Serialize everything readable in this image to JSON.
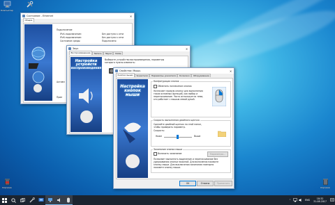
{
  "desktop": {
    "icons": [
      {
        "label": "Компьютер"
      },
      {
        "label": ""
      },
      {
        "label": "Корзина"
      },
      {
        "label": "Корзина"
      }
    ]
  },
  "win1": {
    "title": "Состояние - Ethernet",
    "tab": "Общие",
    "heading": "Подключение",
    "rows": [
      {
        "label": "IPv4-подключение:",
        "value": "Без доступа к сети"
      },
      {
        "label": "IPv6-подключение:",
        "value": "Без доступа к сети"
      },
      {
        "label": "Состояние среды:",
        "value": "Подключено"
      }
    ],
    "extra1": "Активн",
    "extra2": "Прие"
  },
  "win2": {
    "title": "Звук",
    "tabs": [
      "Воспроизведение",
      "Запись",
      "Звуки",
      "Связь"
    ],
    "desc": [
      "Выберите устройство воспроизведения, параметры",
      "которого нужно изменить:"
    ],
    "banner": [
      "Настройка",
      "устройств",
      "воспроизведения"
    ]
  },
  "win3": {
    "title": "Свойства: Мышь",
    "tabs": [
      "Кнопки мыши",
      "Указатели",
      "Параметры указателя",
      "Колесико",
      "Оборудование"
    ],
    "banner": [
      "Настройка",
      "кнопок",
      "мыши"
    ],
    "group1": {
      "title": "Конфигурация кнопок",
      "checkbox": "Обменять назначение кнопок",
      "desc": [
        "Назначает правую кнопку для выполнения",
        "таких основных функций, как выбор и",
        "перетаскивание. Часто используется теми,",
        "кто работает с мышью левой рукой."
      ]
    },
    "group2": {
      "title": "Скорость выполнения двойного щелчка",
      "desc": [
        "Сделайте двойной щелчок по этой папке,",
        "чтобы проверить параметр."
      ],
      "speed_label": "Скорость:",
      "low": "Ниже",
      "high": "Выше",
      "slider_value": 0.5
    },
    "group3": {
      "title": "Залипание кнопки мыши",
      "checkbox": "Включить залипание",
      "params_button": "Параметры...",
      "desc": [
        "Позволяет выполнять выделение и перетаскивание без",
        "удерживания кнопки нажатой. Для включения нажмите",
        "кнопку мыши. Для выключения залипания повторно",
        "нажмите кнопку мыши."
      ]
    },
    "buttons": {
      "ok": "OK",
      "cancel": "Отмена",
      "apply": "Применить"
    }
  },
  "taskbar": {
    "lang": "ENG",
    "time": "18:32",
    "date": "31.08.2017"
  },
  "colors": {
    "accent": "#0078d7",
    "taskbar": "#1b2430",
    "banner": "#2a62b8"
  }
}
